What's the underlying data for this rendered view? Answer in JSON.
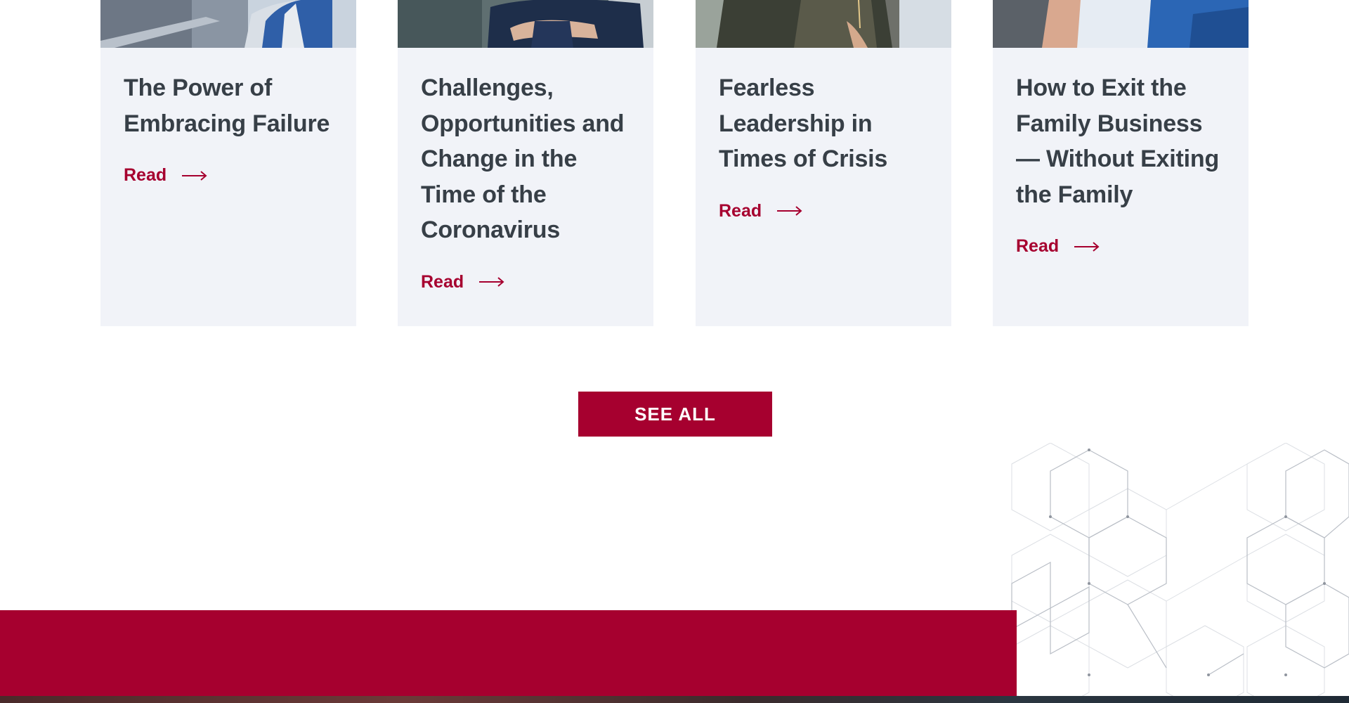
{
  "articles": [
    {
      "title": "The Power of Embracing Failure",
      "link_label": "Read",
      "image_icon": "businesswoman-photo"
    },
    {
      "title": "Challenges, Opportunities and Change in the Time of the Coronavirus",
      "link_label": "Read",
      "image_icon": "businessman-crossed-arms-photo"
    },
    {
      "title": "Fearless Leadership in Times of Crisis",
      "link_label": "Read",
      "image_icon": "team-meeting-photo"
    },
    {
      "title": "How to Exit the Family Business — Without Exiting the Family",
      "link_label": "Read",
      "image_icon": "family-business-photo"
    }
  ],
  "see_all_label": "SEE ALL",
  "colors": {
    "accent": "#a6002f",
    "title_text": "#373f47",
    "card_background": "#f1f3f8",
    "page_background": "#ffffff"
  }
}
